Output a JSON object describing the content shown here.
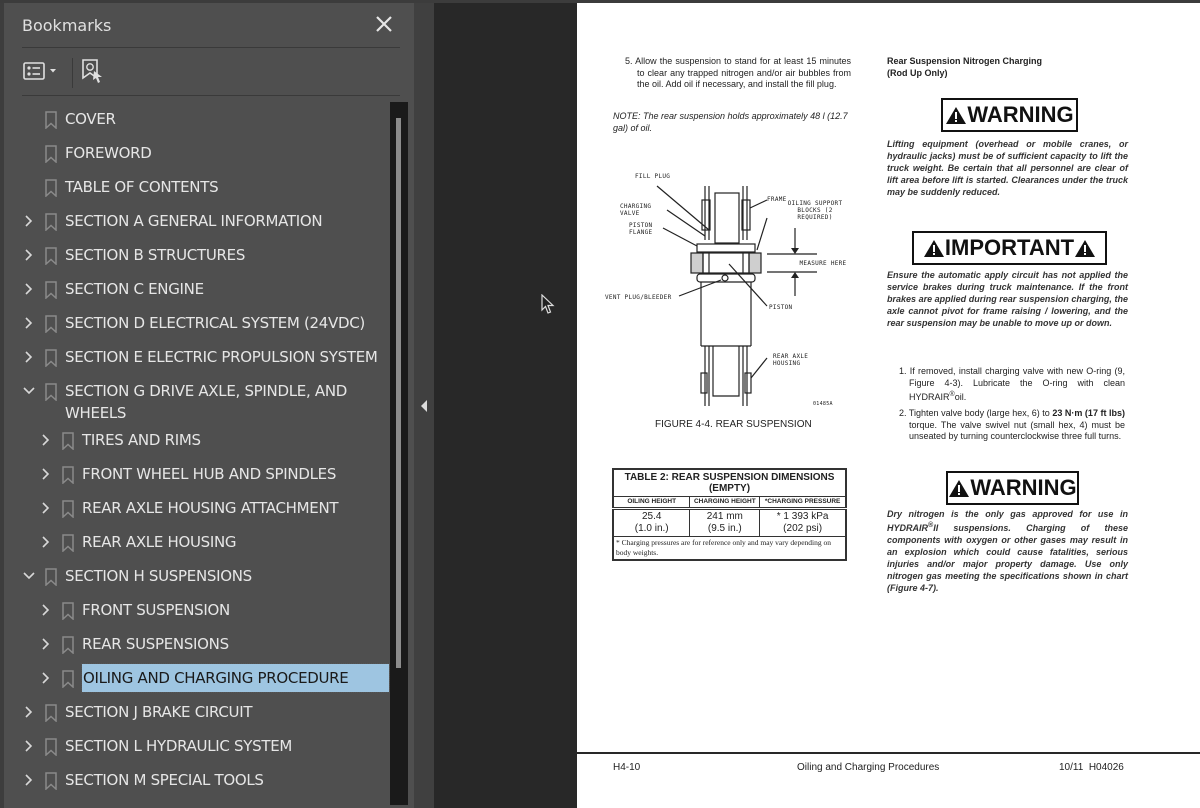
{
  "panel": {
    "title": "Bookmarks",
    "close_label": "close",
    "tools": {
      "options_label": "options",
      "find_current_label": "find current bookmark"
    }
  },
  "bookmarks": [
    {
      "label": "COVER",
      "level": 0,
      "expander": "none"
    },
    {
      "label": "FOREWORD",
      "level": 0,
      "expander": "none"
    },
    {
      "label": "TABLE OF CONTENTS",
      "level": 0,
      "expander": "none"
    },
    {
      "label": "SECTION A GENERAL INFORMATION",
      "level": 0,
      "expander": "collapsed"
    },
    {
      "label": "SECTION B STRUCTURES",
      "level": 0,
      "expander": "collapsed"
    },
    {
      "label": "SECTION C ENGINE",
      "level": 0,
      "expander": "collapsed"
    },
    {
      "label": "SECTION D ELECTRICAL SYSTEM (24VDC)",
      "level": 0,
      "expander": "collapsed"
    },
    {
      "label": "SECTION E ELECTRIC PROPULSION SYSTEM",
      "level": 0,
      "expander": "collapsed"
    },
    {
      "label": "SECTION G DRIVE AXLE, SPINDLE, AND WHEELS",
      "level": 0,
      "expander": "expanded"
    },
    {
      "label": "TIRES AND RIMS",
      "level": 1,
      "expander": "collapsed"
    },
    {
      "label": "FRONT WHEEL HUB AND SPINDLES",
      "level": 1,
      "expander": "collapsed"
    },
    {
      "label": "REAR AXLE HOUSING ATTACHMENT",
      "level": 1,
      "expander": "collapsed"
    },
    {
      "label": "REAR AXLE HOUSING",
      "level": 1,
      "expander": "collapsed"
    },
    {
      "label": "SECTION H SUSPENSIONS",
      "level": 0,
      "expander": "expanded"
    },
    {
      "label": "FRONT SUSPENSION",
      "level": 1,
      "expander": "collapsed"
    },
    {
      "label": "REAR SUSPENSIONS",
      "level": 1,
      "expander": "collapsed"
    },
    {
      "label": "OILING AND CHARGING PROCEDURE",
      "level": 1,
      "expander": "collapsed",
      "selected": true
    },
    {
      "label": "SECTION J BRAKE CIRCUIT",
      "level": 0,
      "expander": "collapsed"
    },
    {
      "label": "SECTION L  HYDRAULIC SYSTEM",
      "level": 0,
      "expander": "collapsed"
    },
    {
      "label": "SECTION M SPECIAL TOOLS",
      "level": 0,
      "expander": "collapsed"
    }
  ],
  "colors": {
    "selection": "#9ec5e1",
    "panel_bg": "#4f4f4f",
    "viewer_bg": "#282828"
  },
  "document": {
    "left_column": {
      "step5": "5. Allow the suspension to stand for at least 15 minutes to clear any trapped nitrogen and/or air bubbles from the oil. Add oil if necessary, and install the fill plug.",
      "note": "NOTE: The rear suspension holds approximately 48 l (12.7 gal) of oil.",
      "figure": {
        "labels": {
          "fill_plug": "FILL PLUG",
          "charging_valve": "CHARGING VALVE",
          "piston_flange": "PISTON FLANGE",
          "frame": "FRAME",
          "oiling_blocks": "OILING SUPPORT BLOCKS (2 REQUIRED)",
          "measure_here": "MEASURE HERE",
          "vent_plug": "VENT PLUG/BLEEDER",
          "piston": "PISTON",
          "rear_axle": "REAR AXLE HOUSING",
          "fig_id": "01485A"
        },
        "caption": "FIGURE 4-4. REAR SUSPENSION"
      },
      "table": {
        "title": "TABLE 2: REAR SUSPENSION DIMENSIONS (EMPTY)",
        "headers": [
          "OILING HEIGHT",
          "CHARGING HEIGHT",
          "*CHARGING PRESSURE"
        ],
        "row": [
          [
            "25.4",
            "(1.0 in.)"
          ],
          [
            "241 mm",
            "(9.5 in.)"
          ],
          [
            "* 1 393 kPa",
            "(202 psi)"
          ]
        ],
        "footnote": "* Charging pressures are for reference only and may vary depending on body weights."
      }
    },
    "right_column": {
      "heading_line1": "Rear Suspension Nitrogen Charging",
      "heading_line2": "(Rod Up Only)",
      "warning1_label": "WARNING",
      "warning1_text": "Lifting equipment (overhead or mobile cranes, or hydraulic jacks) must be of sufficient capacity to lift the truck weight. Be certain that all personnel are clear of lift area before lift is started. Clearances under the truck may be suddenly reduced.",
      "important_label": "IMPORTANT",
      "important_text": "Ensure the automatic apply circuit has not applied the service brakes during truck maintenance. If the front brakes are applied during rear suspension charging, the axle cannot pivot for frame raising / lowering, and the rear suspension may be unable to move up or down.",
      "step1_a": "1. If removed, install charging valve with new O-ring (9, Figure 4-3). Lubricate the O-ring with clean HYDRAIR",
      "step1_b": "oil.",
      "step2_a": "2. Tighten valve body (large hex, 6) to ",
      "step2_bold": "23 N·m (17 ft lbs)",
      "step2_b": " torque. The valve swivel nut (small hex, 4) must be unseated by turning counterclockwise three full turns.",
      "warning2_label": "WARNING",
      "warning2_text_a": "Dry nitrogen is the only gas approved for use in HYDRAIR",
      "warning2_text_b": "II suspensions. Charging of these components with oxygen or other gases may result in an explosion which could cause fatalities, serious injuries and/or major property damage. Use only nitrogen gas meeting the specifications shown in chart (Figure 4-7).",
      "reg": "®"
    },
    "footer": {
      "page_number": "H4-10",
      "title": "Oiling and Charging Procedures",
      "code": "10/11  H04026"
    }
  }
}
